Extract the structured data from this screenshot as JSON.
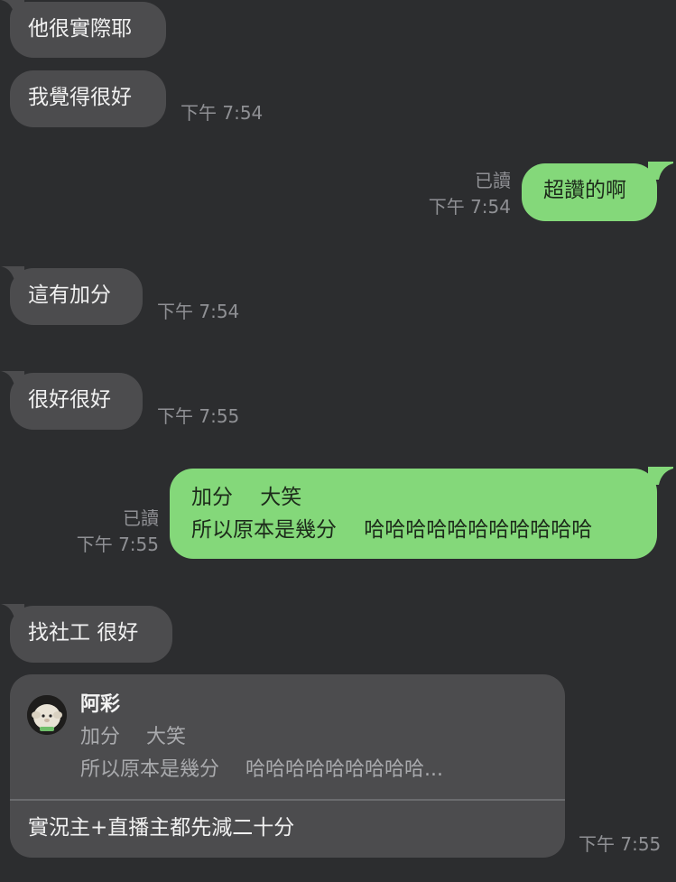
{
  "messages": [
    {
      "text": "他很實際耶"
    },
    {
      "text": "我覺得很好",
      "time": "下午 7:54"
    },
    {
      "text": "超讚的啊",
      "read": "已讀",
      "time": "下午 7:54"
    },
    {
      "text": "這有加分",
      "time": "下午 7:54"
    },
    {
      "text": "很好很好",
      "time": "下午 7:55"
    },
    {
      "lines": [
        "加分　 大笑",
        "所以原本是幾分　 哈哈哈哈哈哈哈哈哈哈哈"
      ],
      "read": "已讀",
      "time": "下午 7:55"
    },
    {
      "text": "找社工 很好"
    }
  ],
  "quoted_reply": {
    "author": "阿彩",
    "quoted_lines": [
      "加分　 大笑",
      "所以原本是幾分　 哈哈哈哈哈哈哈哈哈..."
    ],
    "reply_text": "實況主+直播主都先減二十分",
    "time": "下午 7:55"
  },
  "colors": {
    "background": "#2c2d2f",
    "incoming_bubble": "#4c4c4e",
    "outgoing_bubble": "#84d87a",
    "meta_text": "#8f9094"
  },
  "icons": {
    "avatar": "sheep-plush-avatar"
  }
}
